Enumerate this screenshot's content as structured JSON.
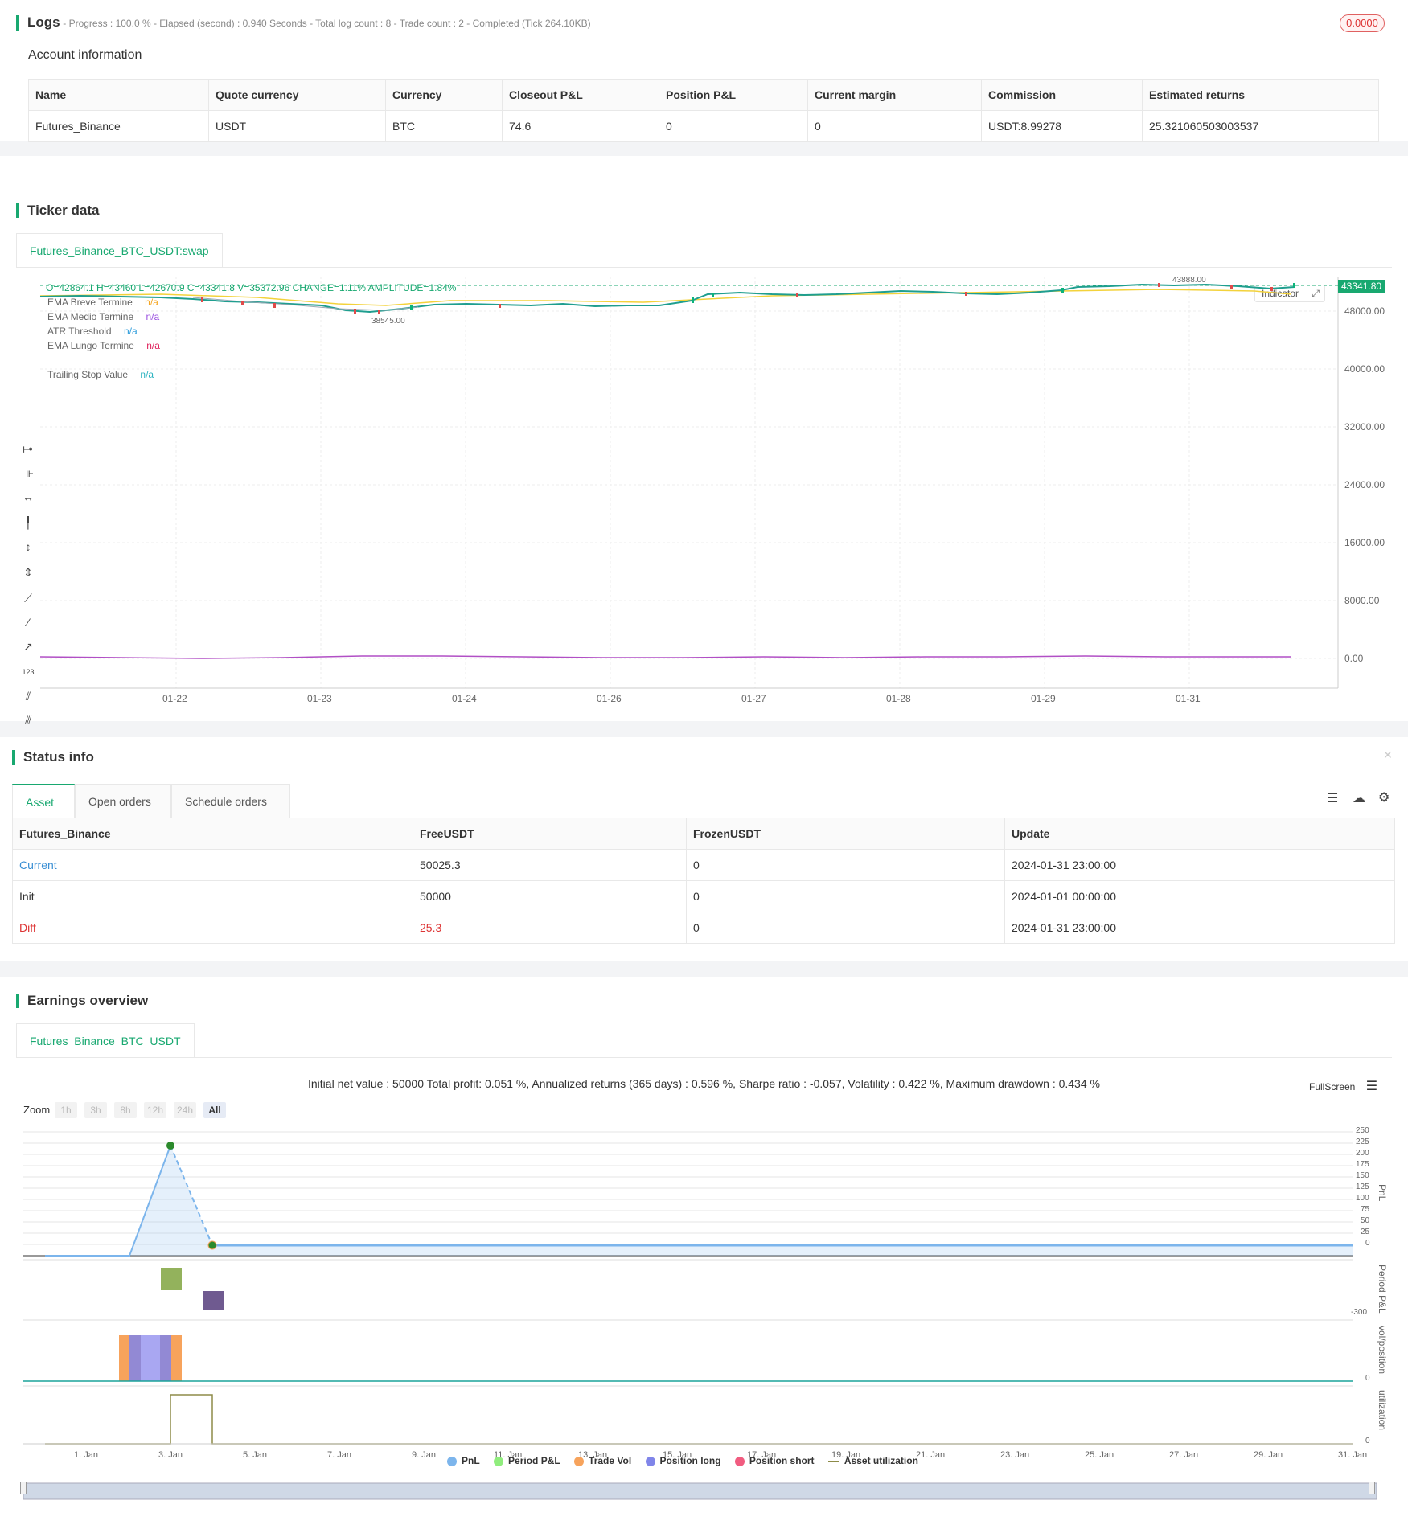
{
  "logs": {
    "title": "Logs",
    "progress": "- Progress : 100.0 % - Elapsed (second) : 0.940  Seconds - Total log count : 8 - Trade count : 2 - Completed (Tick 264.10KB)",
    "badge": "0.0000"
  },
  "account": {
    "title": "Account information",
    "headers": [
      "Name",
      "Quote currency",
      "Currency",
      "Closeout P&L",
      "Position P&L",
      "Current margin",
      "Commission",
      "Estimated returns"
    ],
    "row": [
      "Futures_Binance",
      "USDT",
      "BTC",
      "74.6",
      "0",
      "0",
      "USDT:8.99278",
      "25.321060503003537"
    ]
  },
  "ticker": {
    "title": "Ticker data",
    "tab": "Futures_Binance_BTC_USDT:swap",
    "ohlc": "O=42864.1 H=43460 L=42670.9 C=43341.8 V=35372.96 CHANGE=1.11% AMPLITUDE=1.84%",
    "indicators": [
      {
        "name": "EMA Breve Termine",
        "value": "n/a",
        "color": "#f5a623"
      },
      {
        "name": "EMA Medio Termine",
        "value": "n/a",
        "color": "#9b51e0"
      },
      {
        "name": "ATR Threshold",
        "value": "n/a",
        "color": "#2d9cdb"
      },
      {
        "name": "EMA Lungo Termine",
        "value": "n/a",
        "color": "#e0245e"
      },
      {
        "name": "Trailing Stop Value",
        "value": "n/a",
        "color": "#2bb3c0"
      }
    ],
    "indicator_button": "Indicator",
    "price_label": "43341.80",
    "high_label": "43888.00",
    "low_label": "38545.00",
    "y_ticks": [
      "48000.00",
      "40000.00",
      "32000.00",
      "24000.00",
      "16000.00",
      "8000.00",
      "0.00"
    ],
    "x_ticks": [
      "01-22",
      "01-23",
      "01-24",
      "01-26",
      "01-27",
      "01-28",
      "01-29",
      "01-31"
    ]
  },
  "status": {
    "title": "Status info",
    "tabs": [
      "Asset",
      "Open orders",
      "Schedule orders"
    ],
    "headers": [
      "Futures_Binance",
      "FreeUSDT",
      "FrozenUSDT",
      "Update"
    ],
    "rows": [
      [
        "Current",
        "50025.3",
        "0",
        "2024-01-31 23:00:00"
      ],
      [
        "Init",
        "50000",
        "0",
        "2024-01-01 00:00:00"
      ],
      [
        "Diff",
        "25.3",
        "0",
        "2024-01-31 23:00:00"
      ]
    ]
  },
  "earnings": {
    "title": "Earnings overview",
    "tab": "Futures_Binance_BTC_USDT",
    "summary": "Initial net value : 50000 Total profit: 0.051 %, Annualized returns (365 days) : 0.596 %, Sharpe ratio : -0.057, Volatility : 0.422 %, Maximum drawdown : 0.434 %",
    "fullscreen": "FullScreen",
    "zoom_label": "Zoom",
    "zoom_options": [
      "1h",
      "3h",
      "8h",
      "12h",
      "24h",
      "All"
    ],
    "pnl_ticks": [
      "250",
      "225",
      "200",
      "175",
      "150",
      "125",
      "100",
      "75",
      "50",
      "25",
      "0"
    ],
    "period_tick": "-300",
    "vol_tick": "0",
    "util_tick": "0",
    "axis_names": [
      "PnL",
      "Period P&L",
      "vol/position",
      "utilization"
    ],
    "x_ticks": [
      "1. Jan",
      "3. Jan",
      "5. Jan",
      "7. Jan",
      "9. Jan",
      "11. Jan",
      "13. Jan",
      "15. Jan",
      "17. Jan",
      "19. Jan",
      "21. Jan",
      "23. Jan",
      "25. Jan",
      "27. Jan",
      "29. Jan",
      "31. Jan"
    ],
    "legend": [
      {
        "name": "PnL",
        "color": "#7cb5ec"
      },
      {
        "name": "Period P&L",
        "color": "#90ed7d"
      },
      {
        "name": "Trade Vol",
        "color": "#f7a35c"
      },
      {
        "name": "Position long",
        "color": "#8085e9"
      },
      {
        "name": "Position short",
        "color": "#f15c80"
      },
      {
        "name": "Asset utilization",
        "color": "#8d8b48"
      }
    ]
  }
}
